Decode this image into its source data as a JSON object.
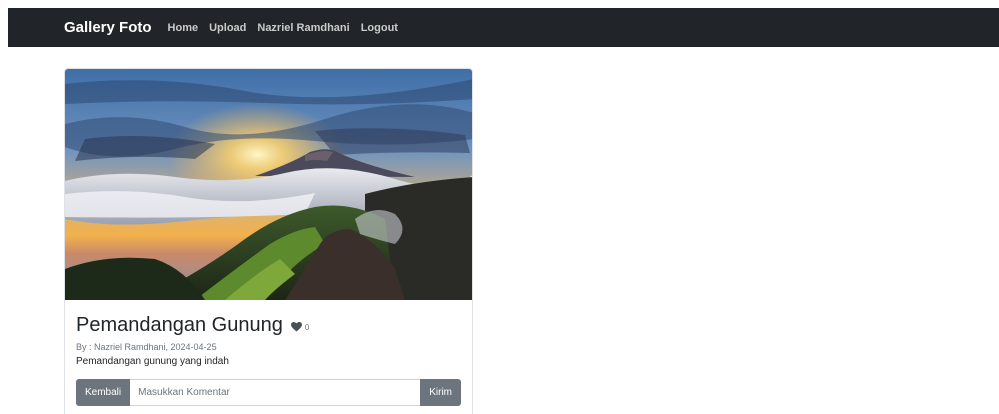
{
  "navbar": {
    "brand": "Gallery Foto",
    "links": [
      "Home",
      "Upload",
      "Nazriel Ramdhani",
      "Logout"
    ]
  },
  "photo": {
    "title": "Pemandangan Gunung",
    "like_icon": "heart-icon",
    "like_count": "0",
    "meta": "By : Nazriel Ramdhani, 2024-04-25",
    "description": "Pemandangan gunung yang indah"
  },
  "comment": {
    "back_label": "Kembali",
    "placeholder": "Masukkan Komentar",
    "send_label": "Kirim"
  },
  "colors": {
    "navbar_bg": "#212529",
    "button_bg": "#6c757d"
  }
}
